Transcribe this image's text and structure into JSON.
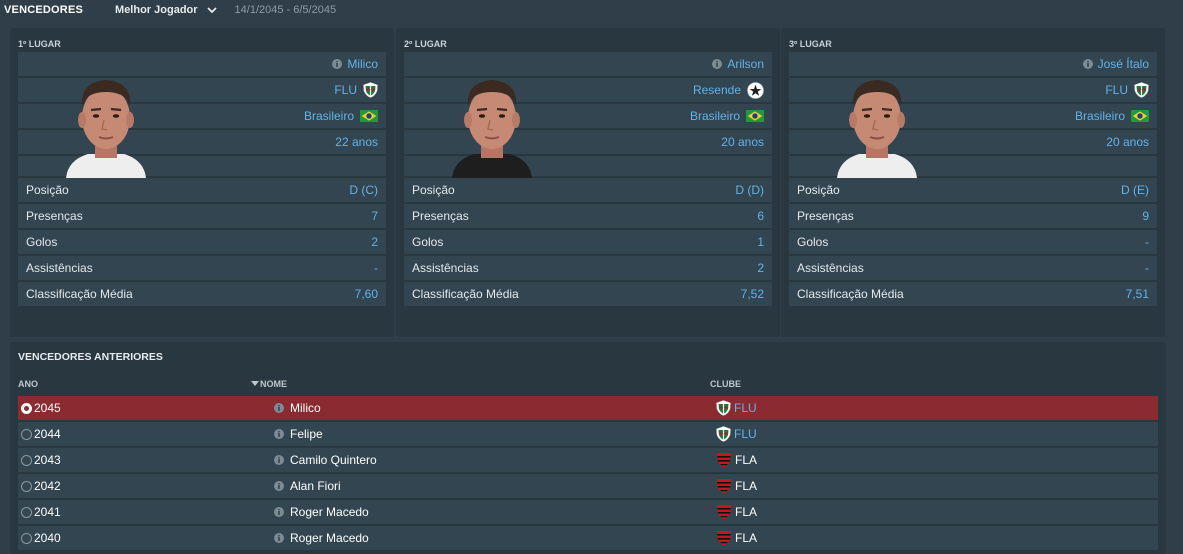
{
  "header": {
    "title": "VENCEDORES",
    "award": "Melhor Jogador",
    "dates": "14/1/2045 - 6/5/2045"
  },
  "winners": [
    {
      "place": "1º LUGAR",
      "name": "Milico",
      "club": "FLU",
      "club_badge": "fluminense-badge-icon",
      "nationality": "Brasileiro",
      "age": "22 anos",
      "shirt_color": "#eeeeee",
      "stats": [
        {
          "label": "Posição",
          "value": "D (C)"
        },
        {
          "label": "Presenças",
          "value": "7"
        },
        {
          "label": "Golos",
          "value": "2"
        },
        {
          "label": "Assistências",
          "value": "-"
        },
        {
          "label": "Classificação Média",
          "value": "7,60"
        }
      ]
    },
    {
      "place": "2º LUGAR",
      "name": "Arilson",
      "club": "Resende",
      "club_badge": "resende-badge-icon",
      "nationality": "Brasileiro",
      "age": "20 anos",
      "shirt_color": "#1e1e1e",
      "stats": [
        {
          "label": "Posição",
          "value": "D (D)"
        },
        {
          "label": "Presenças",
          "value": "6"
        },
        {
          "label": "Golos",
          "value": "1"
        },
        {
          "label": "Assistências",
          "value": "2"
        },
        {
          "label": "Classificação Média",
          "value": "7,52"
        }
      ]
    },
    {
      "place": "3º LUGAR",
      "name": "José Ítalo",
      "club": "FLU",
      "club_badge": "fluminense-badge-icon",
      "nationality": "Brasileiro",
      "age": "20 anos",
      "shirt_color": "#eeeeee",
      "stats": [
        {
          "label": "Posição",
          "value": "D (E)"
        },
        {
          "label": "Presenças",
          "value": "9"
        },
        {
          "label": "Golos",
          "value": "-"
        },
        {
          "label": "Assistências",
          "value": "-"
        },
        {
          "label": "Classificação Média",
          "value": "7,51"
        }
      ]
    }
  ],
  "previous": {
    "title": "VENCEDORES ANTERIORES",
    "columns": [
      "ANO",
      "NOME",
      "CLUBE"
    ],
    "sort_indicator": "sort-desc-icon",
    "rows": [
      {
        "year": "2045",
        "name": "Milico",
        "club": "FLU",
        "badge": "fluminense-badge-icon",
        "selected": true
      },
      {
        "year": "2044",
        "name": "Felipe",
        "club": "FLU",
        "badge": "fluminense-badge-icon",
        "selected": false
      },
      {
        "year": "2043",
        "name": "Camilo Quintero",
        "club": "FLA",
        "badge": "flamengo-badge-icon",
        "selected": false
      },
      {
        "year": "2042",
        "name": "Alan Fiori",
        "club": "FLA",
        "badge": "flamengo-badge-icon",
        "selected": false
      },
      {
        "year": "2041",
        "name": "Roger Macedo",
        "club": "FLA",
        "badge": "flamengo-badge-icon",
        "selected": false
      },
      {
        "year": "2040",
        "name": "Roger Macedo",
        "club": "FLA",
        "badge": "flamengo-badge-icon",
        "selected": false
      }
    ]
  },
  "colors": {
    "background": "#2f3e48",
    "panel": "#283740",
    "row": "#324550",
    "accent_text": "#62b3eb",
    "selected_row": "#8c2a31"
  }
}
